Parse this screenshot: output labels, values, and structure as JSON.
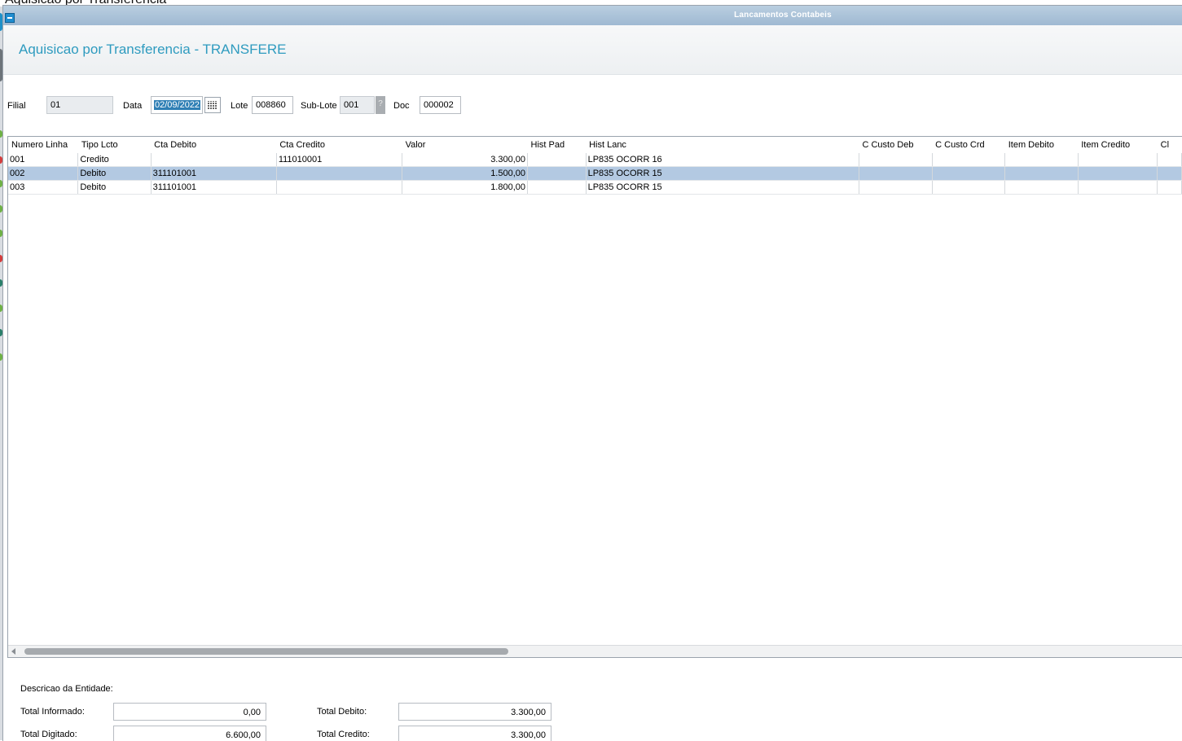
{
  "background_window_title": "Aquisicao por Transferencia",
  "window": {
    "title": "Lancamentos Contabeis"
  },
  "page_title": "Aquisicao por Transferencia - TRANSFERE",
  "form": {
    "filial_label": "Filial",
    "filial_value": "01",
    "data_label": "Data",
    "data_value": "02/09/2022",
    "lote_label": "Lote",
    "lote_value": "008860",
    "sublote_label": "Sub-Lote",
    "sublote_value": "001",
    "sublote_help": "?",
    "doc_label": "Doc",
    "doc_value": "000002"
  },
  "grid": {
    "columns": [
      "Numero Linha",
      "Tipo Lcto",
      "Cta Debito",
      "Cta Credito",
      "Valor",
      "Hist Pad",
      "Hist Lanc",
      "C Custo Deb",
      "C Custo Crd",
      "Item Debito",
      "Item Credito",
      "Cl"
    ],
    "rows": [
      {
        "linha": "001",
        "tipo": "Credito",
        "cta_debito": "",
        "cta_credito": "111010001",
        "valor": "3.300,00",
        "hist_pad": "",
        "hist_lanc": "LP835 OCORR 16",
        "ccusto_deb": "",
        "ccusto_crd": "",
        "item_deb": "",
        "item_crd": "",
        "cl": "",
        "selected": false
      },
      {
        "linha": "002",
        "tipo": "Debito",
        "cta_debito": "311101001",
        "cta_credito": "",
        "valor": "1.500,00",
        "hist_pad": "",
        "hist_lanc": "LP835 OCORR 15",
        "ccusto_deb": "",
        "ccusto_crd": "",
        "item_deb": "",
        "item_crd": "",
        "cl": "",
        "selected": true
      },
      {
        "linha": "003",
        "tipo": "Debito",
        "cta_debito": "311101001",
        "cta_credito": "",
        "valor": "1.800,00",
        "hist_pad": "",
        "hist_lanc": "LP835 OCORR 15",
        "ccusto_deb": "",
        "ccusto_crd": "",
        "item_deb": "",
        "item_crd": "",
        "cl": "",
        "selected": false
      }
    ]
  },
  "footer": {
    "descricao_label": "Descricao da Entidade:",
    "total_informado_label": "Total Informado:",
    "total_informado_value": "0,00",
    "total_digitado_label": "Total Digitado:",
    "total_digitado_value": "6.600,00",
    "total_debito_label": "Total Debito:",
    "total_debito_value": "3.300,00",
    "total_credito_label": "Total Credito:",
    "total_credito_value": "3.300,00"
  },
  "colors": {
    "title_text": "#2e9bbf",
    "titlebar": "#a9c2da",
    "selected_row": "#b3c9e2",
    "date_highlight": "#2f7fb5"
  }
}
